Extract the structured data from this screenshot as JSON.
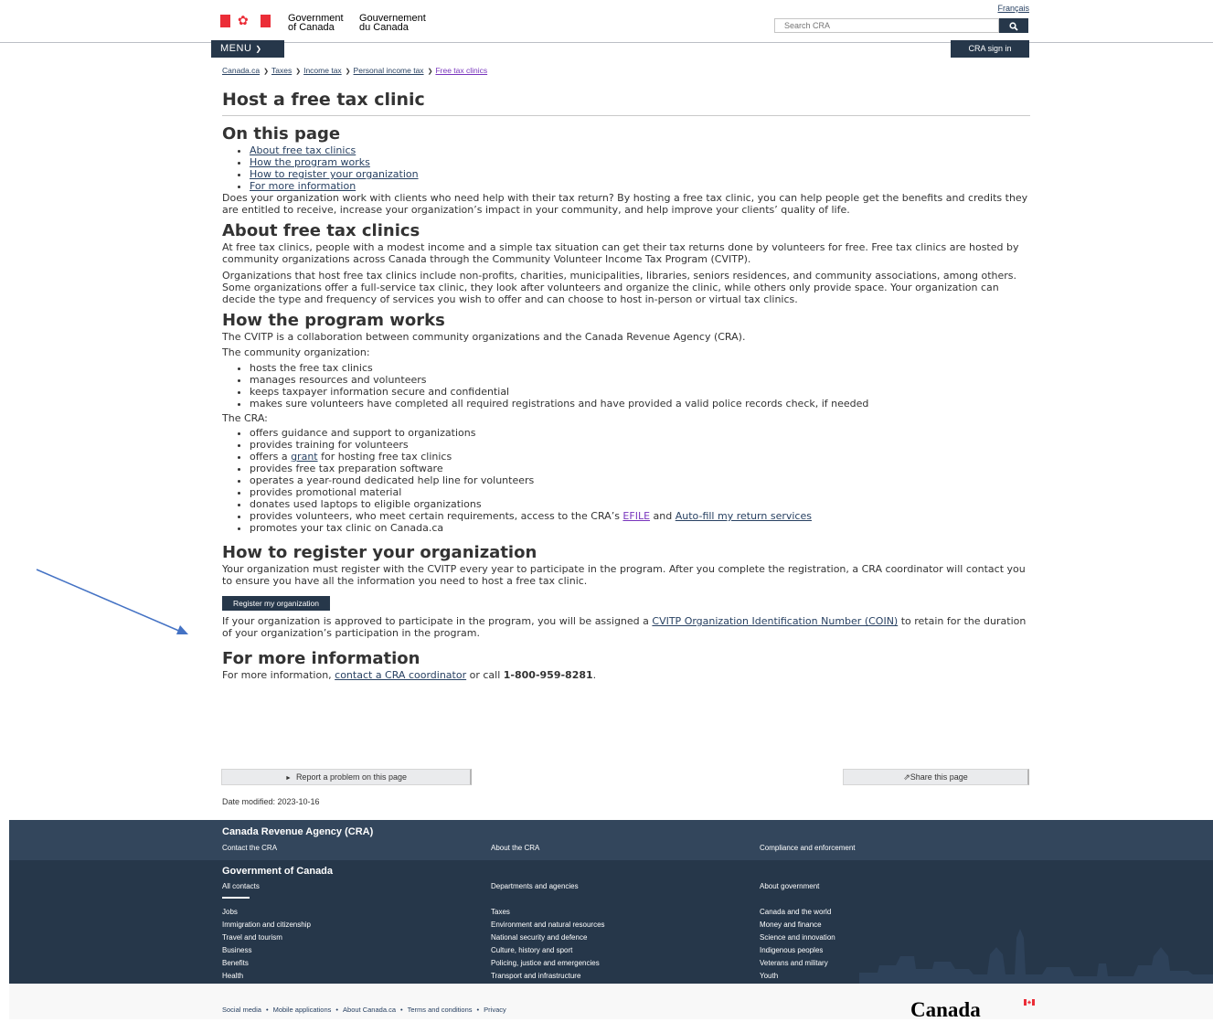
{
  "header": {
    "gov_en_1": "Government",
    "gov_en_2": "of Canada",
    "gov_fr_1": "Gouvernement",
    "gov_fr_2": "du Canada",
    "language_link": "Français",
    "search_placeholder": "Search CRA",
    "menu_label": "MENU",
    "signin_label": "CRA sign in"
  },
  "breadcrumbs": [
    "Canada.ca",
    "Taxes",
    "Income tax",
    "Personal income tax",
    "Free tax clinics"
  ],
  "page_title": "Host a free tax clinic",
  "toc": {
    "heading": "On this page",
    "items": [
      "About free tax clinics",
      "How the program works",
      "How to register your organization",
      "For more information"
    ]
  },
  "intro": "Does your organization work with clients who need help with their tax return? By hosting a free tax clinic, you can help people get the benefits and credits they are entitled to receive, increase your organization’s impact in your community, and help improve your clients’ quality of life.",
  "about": {
    "heading": "About free tax clinics",
    "p1": "At free tax clinics, people with a modest income and a simple tax situation can get their tax returns done by volunteers for free. Free tax clinics are hosted by community organizations across Canada through the Community Volunteer Income Tax Program (CVITP).",
    "p2": "Organizations that host free tax clinics include non-profits, charities, municipalities, libraries, seniors residences, and community associations, among others. Some organizations offer a full-service tax clinic, they look after volunteers and organize the clinic, while others only provide space. Your organization can decide the type and frequency of services you wish to offer and can choose to host in-person or virtual tax clinics."
  },
  "program": {
    "heading": "How the program works",
    "intro": "The CVITP is a collaboration between community organizations and the Canada Revenue Agency (CRA).",
    "community_label": "The community organization:",
    "community_items": [
      "hosts the free tax clinics",
      "manages resources and volunteers",
      "keeps taxpayer information secure and confidential",
      "makes sure volunteers have completed all required registrations and have provided a valid police records check, if needed"
    ],
    "cra_label": "The CRA:",
    "cra_items": [
      "offers guidance and support to organizations",
      "provides training for volunteers",
      "provides free tax preparation software",
      "operates a year-round dedicated help line for volunteers",
      "provides promotional material",
      "donates used laptops to eligible organizations",
      "promotes your tax clinic on Canada.ca"
    ],
    "grant_pre": "offers a ",
    "grant_link": "grant",
    "grant_post": " for hosting free tax clinics",
    "access_pre": "provides volunteers, who meet certain requirements, access to the CRA’s ",
    "access_link1": "EFILE",
    "access_mid": " and ",
    "access_link2": "Auto-fill my return services"
  },
  "register": {
    "heading": "How to register your organization",
    "p1": "Your organization must register with the CVITP every year to participate in the program. After you complete the registration, a CRA coordinator will contact you to ensure you have all the information you need to host a free tax clinic.",
    "button": "Register my organization",
    "p2_pre": "If your organization is approved to participate in the program, you will be assigned a ",
    "p2_link": "CVITP Organization Identification Number (COIN)",
    "p2_post": " to retain for the duration of your organization’s participation in the program."
  },
  "more": {
    "heading": "For more information",
    "pre": "For more information, ",
    "link": "contact a CRA coordinator",
    "mid": " or call ",
    "phone": "1-800-959-8281",
    "post": "."
  },
  "page_actions": {
    "report": "Report a problem on this page",
    "share": "Share this page",
    "date_modified": "Date modified: 2023-10-16"
  },
  "footer": {
    "cra_title": "Canada Revenue Agency (CRA)",
    "cra_links": [
      "Contact the CRA",
      "About the CRA",
      "Compliance and enforcement"
    ],
    "gov_title": "Government of Canada",
    "gov_links": [
      "All contacts",
      "Departments and agencies",
      "About government"
    ],
    "themes_col1": [
      "Jobs",
      "Immigration and citizenship",
      "Travel and tourism",
      "Business",
      "Benefits",
      "Health"
    ],
    "themes_col2": [
      "Taxes",
      "Environment and natural resources",
      "National security and defence",
      "Culture, history and sport",
      "Policing, justice and emergencies",
      "Transport and infrastructure"
    ],
    "themes_col3": [
      "Canada and the world",
      "Money and finance",
      "Science and innovation",
      "Indigenous peoples",
      "Veterans and military",
      "Youth"
    ],
    "bottom_links": [
      "Social media",
      "Mobile applications",
      "About Canada.ca",
      "Terms and conditions",
      "Privacy"
    ],
    "wordmark": "Canada"
  },
  "colors": {
    "nav_dark": "#26374a",
    "footer_top": "#33465c",
    "link": "#284162",
    "visited": "#7834bc",
    "flag_red": "#eb2d37",
    "annotation_arrow": "#4472c4"
  }
}
